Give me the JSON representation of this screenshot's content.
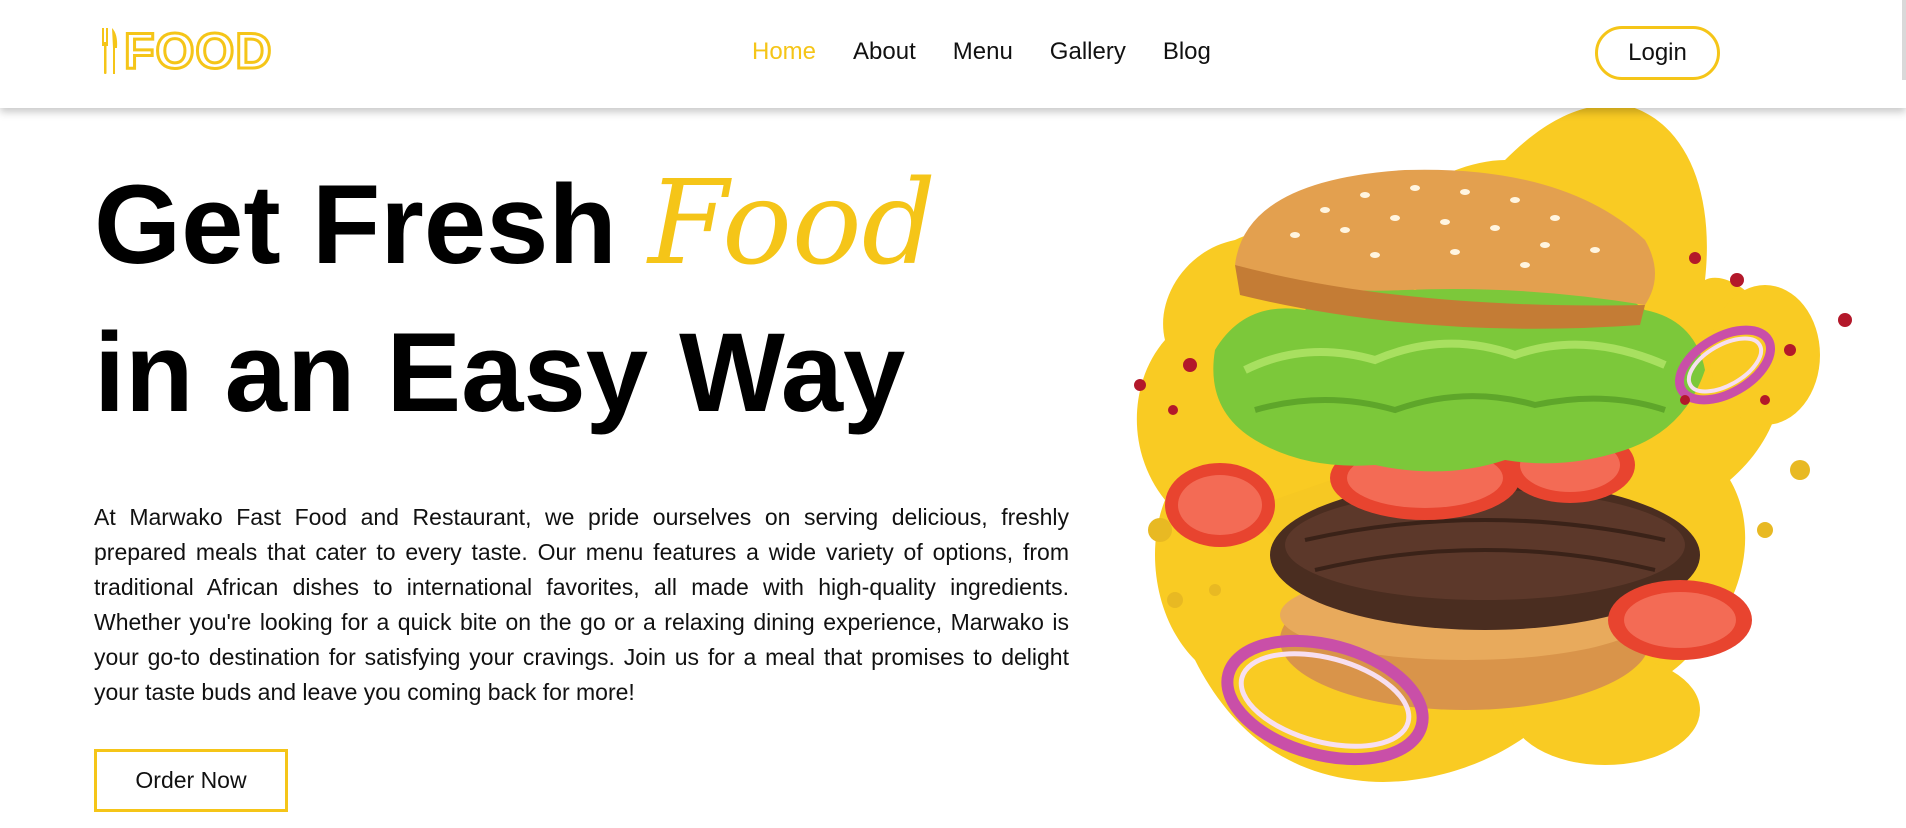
{
  "brand": {
    "logo_text": "FOOD",
    "logo_icon": "fork-knife-icon",
    "accent_color": "#f5c518"
  },
  "nav": {
    "items": [
      {
        "label": "Home",
        "active": true
      },
      {
        "label": "About",
        "active": false
      },
      {
        "label": "Menu",
        "active": false
      },
      {
        "label": "Gallery",
        "active": false
      },
      {
        "label": "Blog",
        "active": false
      }
    ],
    "login_label": "Login"
  },
  "hero": {
    "headline_part1": "Get Fresh ",
    "headline_accent": "Food",
    "headline_part2": "in an Easy Way",
    "description": "At Marwako Fast Food and Restaurant, we pride ourselves on serving delicious, freshly prepared meals that cater to every taste. Our menu features a wide variety of options, from traditional African dishes to international favorites, all made with high-quality ingredients. Whether you're looking for a quick bite on the go or a relaxing dining experience, Marwako is your go-to destination for satisfying your cravings. Join us for a meal that promises to delight your taste buds and leave you coming back for more!",
    "cta_label": "Order Now",
    "image_subject": "burger-illustration"
  }
}
